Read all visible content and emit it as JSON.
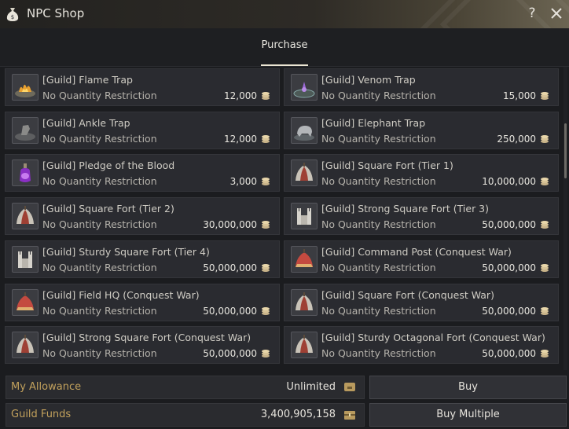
{
  "window": {
    "title": "NPC Shop"
  },
  "tabs": [
    {
      "label": "Purchase"
    }
  ],
  "items": [
    {
      "name": "[Guild] Flame Trap",
      "restriction": "No Quantity Restriction",
      "price": "12,000",
      "icon": "flame-trap-icon"
    },
    {
      "name": "[Guild] Venom Trap",
      "restriction": "No Quantity Restriction",
      "price": "15,000",
      "icon": "venom-trap-icon"
    },
    {
      "name": "[Guild] Ankle Trap",
      "restriction": "No Quantity Restriction",
      "price": "12,000",
      "icon": "ankle-trap-icon"
    },
    {
      "name": "[Guild] Elephant Trap",
      "restriction": "No Quantity Restriction",
      "price": "250,000",
      "icon": "elephant-trap-icon"
    },
    {
      "name": "[Guild] Pledge of the Blood",
      "restriction": "No Quantity Restriction",
      "price": "3,000",
      "icon": "potion-icon"
    },
    {
      "name": "[Guild] Square Fort (Tier 1)",
      "restriction": "No Quantity Restriction",
      "price": "10,000,000",
      "icon": "tent-icon"
    },
    {
      "name": "[Guild] Square Fort (Tier 2)",
      "restriction": "No Quantity Restriction",
      "price": "30,000,000",
      "icon": "tent-icon"
    },
    {
      "name": "[Guild] Strong Square Fort (Tier 3)",
      "restriction": "No Quantity Restriction",
      "price": "50,000,000",
      "icon": "fort-icon"
    },
    {
      "name": "[Guild] Sturdy Square Fort (Tier 4)",
      "restriction": "No Quantity Restriction",
      "price": "50,000,000",
      "icon": "fort-icon"
    },
    {
      "name": "[Guild] Command Post (Conquest War)",
      "restriction": "No Quantity Restriction",
      "price": "50,000,000",
      "icon": "red-tent-icon"
    },
    {
      "name": "[Guild] Field HQ (Conquest War)",
      "restriction": "No Quantity Restriction",
      "price": "50,000,000",
      "icon": "red-tent-icon"
    },
    {
      "name": "[Guild] Square Fort (Conquest War)",
      "restriction": "No Quantity Restriction",
      "price": "50,000,000",
      "icon": "tent-icon"
    },
    {
      "name": "[Guild] Strong Square Fort (Conquest War)",
      "restriction": "No Quantity Restriction",
      "price": "50,000,000",
      "icon": "tent-icon"
    },
    {
      "name": "[Guild] Sturdy Octagonal Fort (Conquest War)",
      "restriction": "No Quantity Restriction",
      "price": "50,000,000",
      "icon": "tent-icon"
    }
  ],
  "footer": {
    "allowance_label": "My Allowance",
    "allowance_value": "Unlimited",
    "funds_label": "Guild Funds",
    "funds_value": "3,400,905,158",
    "buy_label": "Buy",
    "buy_multiple_label": "Buy Multiple"
  },
  "colors": {
    "accent_gold": "#c2a15c",
    "panel_bg": "#2a2b30",
    "window_bg": "#1b1c1f"
  }
}
